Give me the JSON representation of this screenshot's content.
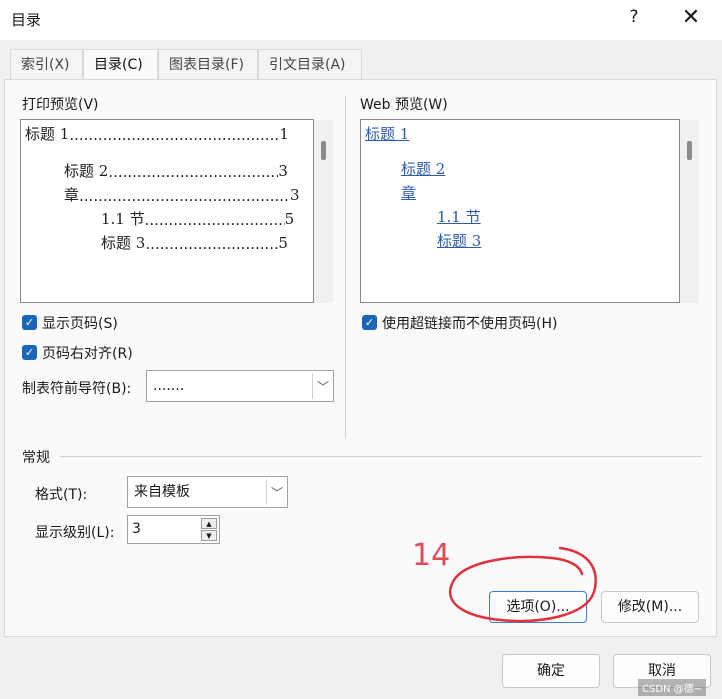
{
  "window": {
    "title": "目录",
    "help": "?",
    "close": "✕"
  },
  "tabs": [
    {
      "label": "索引(X)"
    },
    {
      "label": "目录(C)"
    },
    {
      "label": "图表目录(F)"
    },
    {
      "label": "引文目录(A)"
    }
  ],
  "print_preview": {
    "label": "打印预览(V)",
    "lines": [
      {
        "text": "标题 1",
        "page": "1"
      },
      {
        "text": "标题 2",
        "page": "3"
      },
      {
        "text": "章",
        "page": "3"
      },
      {
        "text": "1.1 节",
        "page": "5"
      },
      {
        "text": "标题 3",
        "page": "5"
      }
    ]
  },
  "web_preview": {
    "label": "Web 预览(W)",
    "links": [
      "标题 1",
      "标题 2",
      "章",
      "1.1 节",
      "标题 3"
    ]
  },
  "options": {
    "show_page_numbers": "显示页码(S)",
    "right_align": "页码右对齐(R)",
    "tab_leader_label": "制表符前导符(B):",
    "tab_leader_value": ".......",
    "use_hyperlinks": "使用超链接而不使用页码(H)"
  },
  "general": {
    "section_label": "常规",
    "format_label": "格式(T):",
    "format_value": "来自模板",
    "levels_label": "显示级别(L):",
    "levels_value": "3"
  },
  "buttons": {
    "options": "选项(O)...",
    "modify": "修改(M)...",
    "ok": "确定",
    "cancel": "取消"
  },
  "annotation": {
    "number": "14"
  },
  "watermark": "CSDN @德~"
}
